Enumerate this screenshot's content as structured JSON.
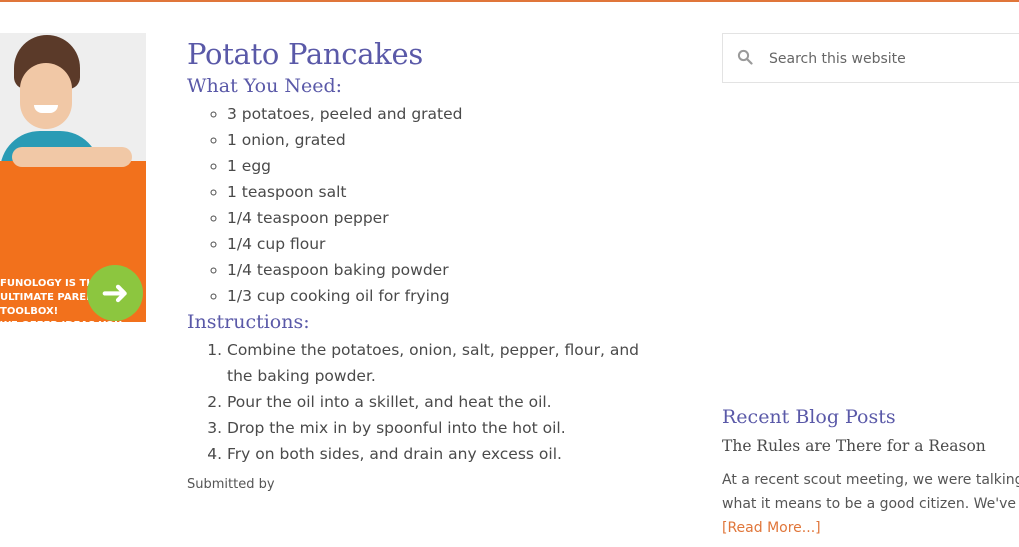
{
  "ad": {
    "tagline": "FUNOLOGY IS THE\nULTIMATE PARENTING\nTOOLBOX!\nWE OFFER IDEAS YOU\nCAN USE TO INSPIRE AND\nENTERTAIN YOUR KIDS\nOFFLINE. SIMPLY PUT,\nWE OFFER THE CURE\nTO BOREDOM!",
    "arrow_icon": "arrow-right-icon"
  },
  "article": {
    "title": "Potato Pancakes",
    "ingredients_heading": "What You Need:",
    "ingredients": [
      "3 potatoes, peeled and grated",
      "1 onion, grated",
      "1 egg",
      "1 teaspoon salt",
      "1/4 teaspoon pepper",
      "1/4 cup flour",
      "1/4 teaspoon baking powder",
      "1/3 cup cooking oil for frying"
    ],
    "instructions_heading": "Instructions:",
    "instructions": [
      "Combine the potatoes, onion, salt, pepper, flour, and the baking powder.",
      "Pour the oil into a skillet, and heat the oil.",
      "Drop the mix in by spoonful into the hot oil.",
      "Fry on both sides, and drain any excess oil."
    ],
    "submitted_by": "Submitted by"
  },
  "search": {
    "placeholder": "Search this website",
    "icon": "search-icon"
  },
  "sidebar": {
    "recent_heading": "Recent Blog Posts",
    "post_title": "The Rules are There for a Reason",
    "excerpt_line1": "At a recent scout meeting, we were talking a",
    "excerpt_line2": "what it means to be a good citizen. We've ha",
    "read_more": "[Read More...]"
  },
  "colors": {
    "accent": "#e0763a",
    "heading": "#5a59a8",
    "ad_orange": "#f2711c",
    "ad_green": "#8cc63f"
  }
}
